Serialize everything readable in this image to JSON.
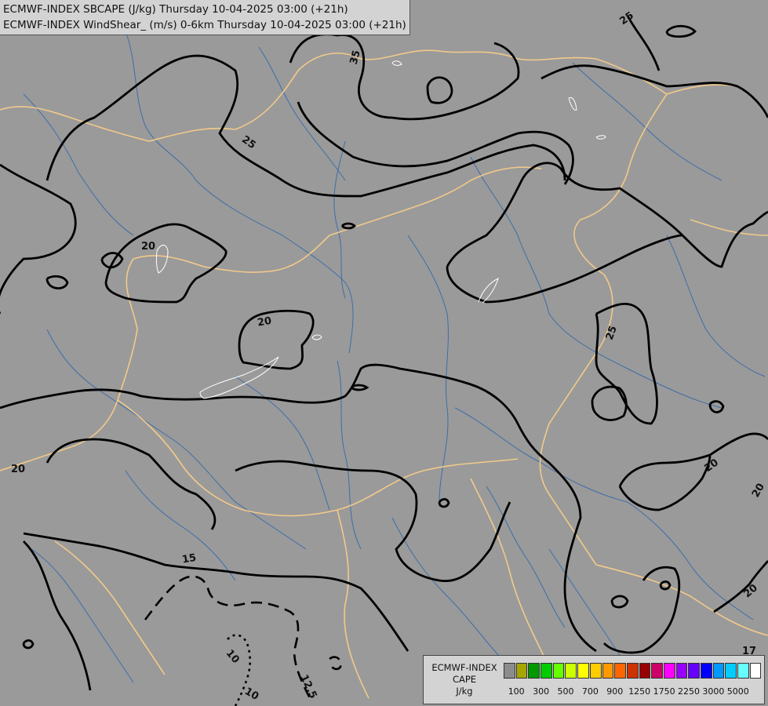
{
  "title": {
    "line1": "ECMWF-INDEX SBCAPE (J/kg) Thursday 10-04-2025 03:00 (+21h)",
    "line2": "ECMWF-INDEX WindShear_ (m/s) 0-6km Thursday 10-04-2025 03:00 (+21h)"
  },
  "contour_labels": [
    "35",
    "25",
    "25",
    "20",
    "20",
    "20",
    "25",
    "20",
    "20",
    "20",
    "15",
    "10",
    "10",
    "12.5",
    "17"
  ],
  "legend": {
    "line1": "ECMWF-INDEX",
    "line2": "CAPE",
    "line3": "J/kg",
    "swatch_colors": [
      "#8c8c8c",
      "#a6a600",
      "#009900",
      "#00cc00",
      "#66ff00",
      "#ccff00",
      "#ffff00",
      "#ffcc00",
      "#ff9900",
      "#ff6600",
      "#cc3300",
      "#990000",
      "#cc0066",
      "#ff00ff",
      "#9900ff",
      "#6600ff",
      "#0000ff",
      "#0099ff",
      "#00ccff",
      "#66ffff",
      "#ffffff"
    ],
    "ticks": [
      "100",
      "300",
      "500",
      "700",
      "900",
      "1250",
      "1750",
      "2250",
      "3000",
      "5000"
    ]
  },
  "colors": {
    "background": "#9a9a9a",
    "borders": "#f2c98a",
    "rivers": "#3c6ea8",
    "contours": "#000000"
  }
}
